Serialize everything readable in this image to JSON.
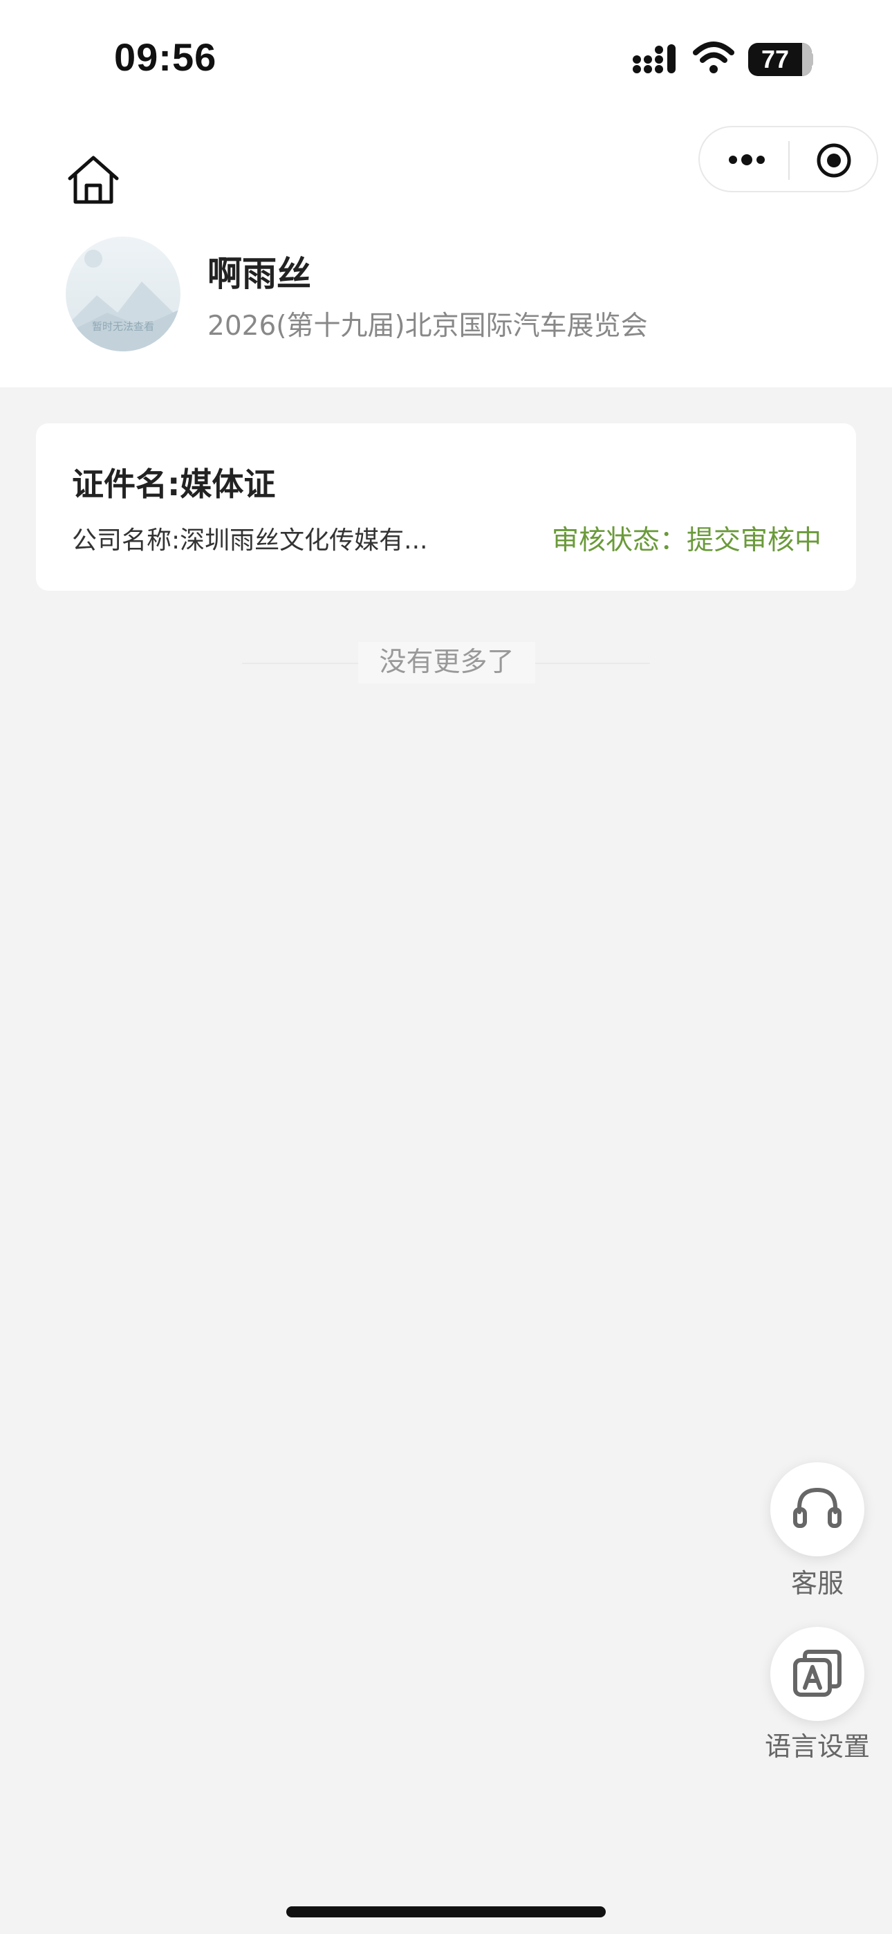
{
  "status_bar": {
    "time": "09:56",
    "battery": "77",
    "icons": [
      "signal-icon",
      "wifi-icon",
      "battery-icon"
    ]
  },
  "header": {
    "icons": [
      "home-icon",
      "more-icon",
      "close-circle-icon"
    ],
    "avatar_placeholder_text": "暂时无法查看",
    "user_name": "啊雨丝",
    "event_name": "2026(第十九届)北京国际汽车展览会"
  },
  "card": {
    "title": "证件名:媒体证",
    "company": "公司名称:深圳雨丝文化传媒有...",
    "review_status": "审核状态：提交审核中",
    "status_color": "#6a9a3a"
  },
  "list_footer": {
    "no_more": "没有更多了"
  },
  "floating_actions": {
    "service": {
      "label": "客服",
      "icon": "headset-icon"
    },
    "language": {
      "label": "语言设置",
      "icon": "translate-icon"
    }
  }
}
